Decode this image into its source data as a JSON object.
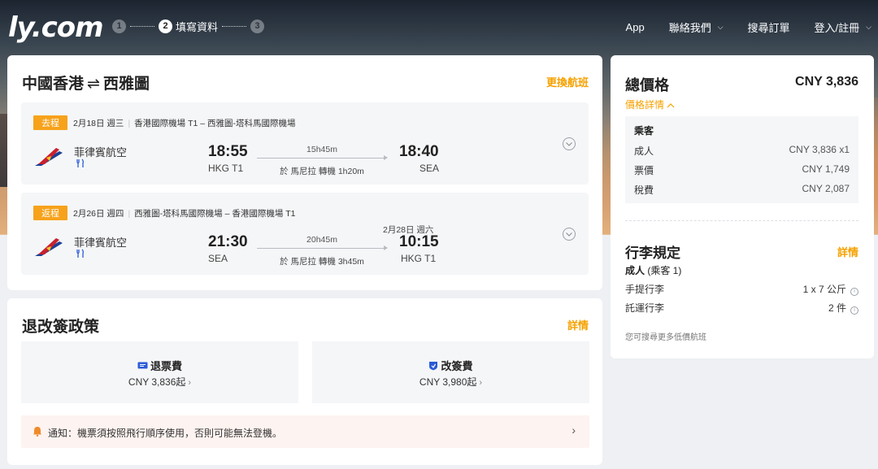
{
  "brand": {
    "logo_text": "ly.com"
  },
  "steps": [
    {
      "num": "1",
      "label": ""
    },
    {
      "num": "2",
      "label": "填寫資料"
    },
    {
      "num": "3",
      "label": ""
    }
  ],
  "nav": {
    "app": "App",
    "contact": "聯絡我們",
    "search_orders": "搜尋訂單",
    "login": "登入/註冊"
  },
  "route": {
    "origin": "中國香港",
    "swap_glyph": "⇌",
    "destination": "西雅圖",
    "change_flight": "更換航班",
    "legs": [
      {
        "tag": "去程",
        "date": "2月18日 週三",
        "airports": "香港國際機場 T1 – 西雅圖-塔科馬國際機場",
        "airline": "菲律賓航空",
        "dep_time": "18:55",
        "dep_code": "HKG T1",
        "duration": "15h45m",
        "stop": "於 馬尼拉 轉機 1h20m",
        "arr_time": "18:40",
        "arr_code": "SEA",
        "arr_date_note": ""
      },
      {
        "tag": "返程",
        "date": "2月26日 週四",
        "airports": "西雅圖-塔科馬國際機場 – 香港國際機場 T1",
        "airline": "菲律賓航空",
        "dep_time": "21:30",
        "dep_code": "SEA",
        "duration": "20h45m",
        "stop": "於 馬尼拉 轉機 3h45m",
        "arr_time": "10:15",
        "arr_code": "HKG T1",
        "arr_date_note": "2月28日 週六"
      }
    ]
  },
  "policy": {
    "title": "退改簽政策",
    "details_link": "詳情",
    "refund": {
      "label": "退票費",
      "value": "CNY 3,836起"
    },
    "change": {
      "label": "改簽費",
      "value": "CNY 3,980起"
    },
    "notice": "通知：機票須按照飛行順序使用，否則可能無法登機。"
  },
  "price": {
    "total_label": "總價格",
    "total_value": "CNY 3,836",
    "details_link": "價格詳情",
    "passengers": {
      "title": "乘客",
      "rows": [
        {
          "label": "成人",
          "value": "CNY 3,836 x1"
        },
        {
          "label": "票價",
          "value": "CNY 1,749"
        },
        {
          "label": "稅費",
          "value": "CNY 2,087"
        }
      ]
    }
  },
  "baggage": {
    "title": "行李規定",
    "details_link": "詳情",
    "sub_bold": "成人",
    "sub_rest": " (乘客 1)",
    "rows": [
      {
        "label": "手提行李",
        "value": "1 x 7 公斤"
      },
      {
        "label": "託運行李",
        "value": "2 件"
      }
    ],
    "note": "您可搜尋更多低價航班"
  },
  "colors": {
    "accent_orange": "#f5a100",
    "tag_orange": "#f7a21b",
    "notice_bg": "#fdf3f0",
    "airline_red": "#c8202e",
    "airline_blue": "#1c3f94",
    "icon_blue": "#2a5bd7"
  }
}
